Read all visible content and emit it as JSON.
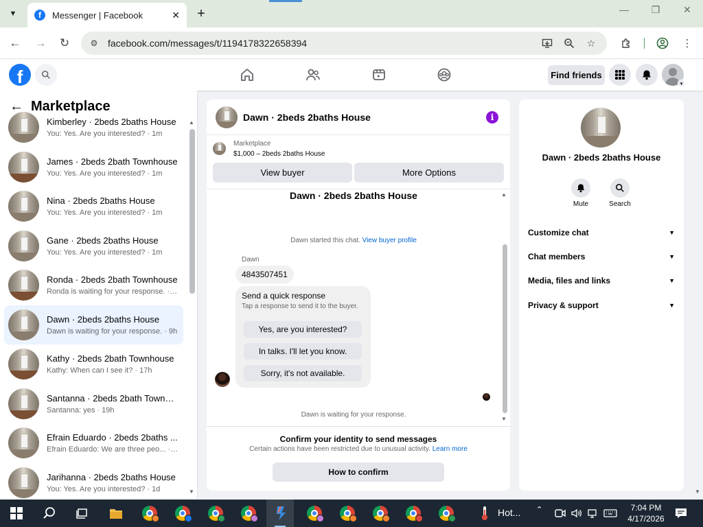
{
  "browser": {
    "tab_title": "Messenger | Facebook",
    "url": "facebook.com/messages/t/1194178322658394",
    "icons": [
      "tab-list-icon",
      "close-tab-icon",
      "new-tab-icon",
      "minimize-icon",
      "restore-icon",
      "close-window-icon",
      "back-icon",
      "forward-icon",
      "reload-icon",
      "site-info-icon",
      "install-app-icon",
      "zoom-icon",
      "bookmark-star-icon",
      "extensions-icon",
      "profile-icon",
      "menu-icon"
    ]
  },
  "fb_header": {
    "logo": "f",
    "find_friends_label": "Find friends",
    "nav_icons": [
      "home-icon",
      "friends-icon",
      "video-icon",
      "groups-icon"
    ]
  },
  "sidebar": {
    "title": "Marketplace",
    "conversations": [
      {
        "name": "Kimberley · 2beds 2baths House",
        "snippet": "You: Yes. Are you interested? · 1m",
        "floor": "carpet",
        "active": false
      },
      {
        "name": "James · 2beds 2bath Townhouse",
        "snippet": "You: Yes. Are you interested? · 1m",
        "floor": "wood",
        "active": false
      },
      {
        "name": "Nina · 2beds 2baths House",
        "snippet": "You: Yes. Are you interested? · 1m",
        "floor": "carpet",
        "active": false
      },
      {
        "name": "Gane · 2beds 2baths House",
        "snippet": "You: Yes. Are you interested? · 1m",
        "floor": "carpet",
        "active": false
      },
      {
        "name": "Ronda · 2beds 2bath Townhouse",
        "snippet": "Ronda is waiting for your response. · 8h",
        "floor": "wood",
        "active": false
      },
      {
        "name": "Dawn · 2beds 2baths House",
        "snippet": "Dawn is waiting for your response. · 9h",
        "floor": "carpet",
        "active": true
      },
      {
        "name": "Kathy · 2beds 2bath Townhouse",
        "snippet": "Kathy: When can I see it? · 17h",
        "floor": "wood",
        "active": false
      },
      {
        "name": "Santanna · 2beds 2bath Townho...",
        "snippet": "Santanna: yes · 19h",
        "floor": "wood",
        "active": false
      },
      {
        "name": "Efrain Eduardo · 2beds 2baths ...",
        "snippet": "Efrain Eduardo: We are three peo... · 22h",
        "floor": "carpet",
        "active": false
      },
      {
        "name": "Jarihanna · 2beds 2baths House",
        "snippet": "You: Yes. Are you interested? · 1d",
        "floor": "carpet",
        "active": false
      }
    ]
  },
  "chat": {
    "header_name": "Dawn · 2beds 2baths House",
    "listing_category": "Marketplace",
    "listing_price": "$1,000 – 2beds 2baths House",
    "view_buyer_label": "View buyer",
    "more_options_label": "More Options",
    "thread_title": "Dawn · 2beds 2baths House",
    "started_text": "Dawn started this chat.",
    "started_link": "View buyer profile",
    "sender": "Dawn",
    "phone_message": "4843507451",
    "quick_title": "Send a quick response",
    "quick_subtitle": "Tap a response to send it to the buyer.",
    "quick_replies": [
      "Yes, are you interested?",
      "In talks. I'll let you know.",
      "Sorry, it's not available."
    ],
    "waiting_text": "Dawn is waiting for your response.",
    "confirm_title": "Confirm your identity to send messages",
    "confirm_text": "Certain actions have been restricted due to unusual activity.",
    "confirm_link": "Learn more",
    "confirm_button": "How to confirm"
  },
  "details": {
    "name": "Dawn · 2beds 2baths House",
    "mute_label": "Mute",
    "search_label": "Search",
    "sections": [
      "Customize chat",
      "Chat members",
      "Media, files and links",
      "Privacy & support"
    ]
  },
  "taskbar": {
    "weather_text": "Hot...",
    "time": "7:04 PM",
    "date": "4/17/2026",
    "apps": [
      "start-icon",
      "search-icon",
      "task-view-icon",
      "file-explorer-icon",
      "chrome-icon",
      "chrome-icon",
      "chrome-icon",
      "chrome-icon",
      "app-icon",
      "chrome-icon",
      "chrome-icon",
      "chrome-icon",
      "chrome-icon",
      "chrome-icon"
    ]
  }
}
